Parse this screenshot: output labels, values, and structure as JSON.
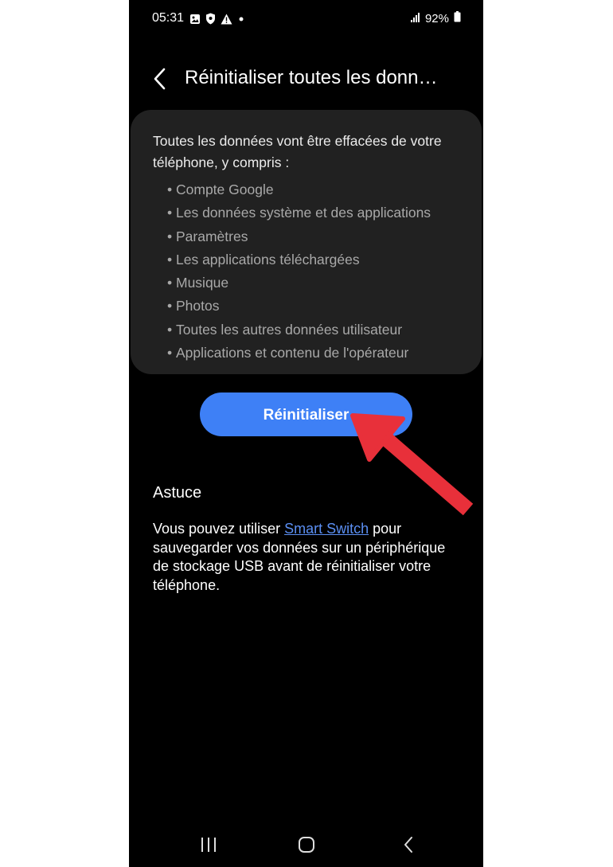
{
  "status_bar": {
    "time": "05:31",
    "battery": "92%",
    "icons_left": [
      "image-icon",
      "shield-icon",
      "warning-icon",
      "dot-icon"
    ],
    "icons_right": [
      "signal-icon",
      "battery-icon"
    ]
  },
  "header": {
    "title": "Réinitialiser toutes les donn…"
  },
  "card": {
    "intro": "Toutes les données vont être effacées de votre téléphone, y compris :",
    "items": [
      "Compte Google",
      "Les données système et des applications",
      "Paramètres",
      "Les applications téléchargées",
      "Musique",
      "Photos",
      "Toutes les autres données utilisateur",
      "Applications et contenu de l'opérateur"
    ]
  },
  "reset_button": {
    "label": "Réinitialiser",
    "color": "#3e80f6"
  },
  "tip": {
    "title": "Astuce",
    "text_before": "Vous pouvez utiliser ",
    "link": "Smart Switch",
    "text_after": " pour sauvegarder vos données sur un périphérique de stockage USB avant de réinitialiser votre téléphone."
  },
  "nav_bar": {
    "icons": [
      "recents-icon",
      "home-icon",
      "back-icon"
    ]
  },
  "annotation": {
    "arrow_color": "#e8303a",
    "points_to": "reset-button"
  }
}
